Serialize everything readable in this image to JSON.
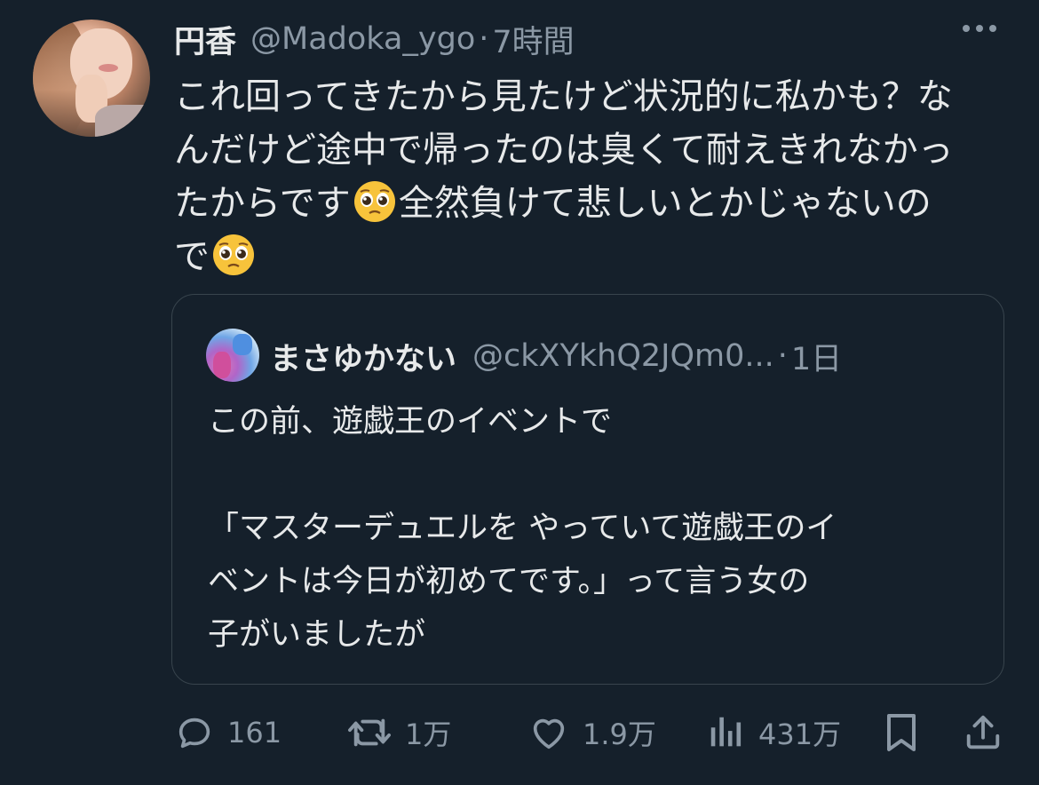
{
  "tweet": {
    "author_name": "円香",
    "author_handle": "@Madoka_ygo",
    "separator": "·",
    "time": "7時間",
    "lines": [
      "これ回ってきたから見たけど状況的に私かも？な",
      "んだけど途中で帰ったのは臭くて耐えきれなかっ",
      "たからです",
      "全然負けて悲しいとかじゃないの",
      "で"
    ],
    "emoji": "pleading-face-emoji"
  },
  "quoted": {
    "author_name": "まさゆかない",
    "author_handle": "@ckXYkhQ2JQm0...",
    "separator": "·",
    "time": "1日",
    "lines": [
      "この前、遊戯王のイベントで",
      "",
      "「マスターデュエルを やっていて遊戯王のイ",
      "ベントは今日が初めてです。」って言う女の",
      "子がいましたが"
    ]
  },
  "actions": {
    "reply_count": "161",
    "retweet_count": "1万",
    "like_count": "1.9万",
    "view_count": "431万"
  },
  "colors": {
    "background": "#15202b",
    "text": "#e7e9ea",
    "muted": "#8b98a5",
    "border": "#38444d"
  }
}
